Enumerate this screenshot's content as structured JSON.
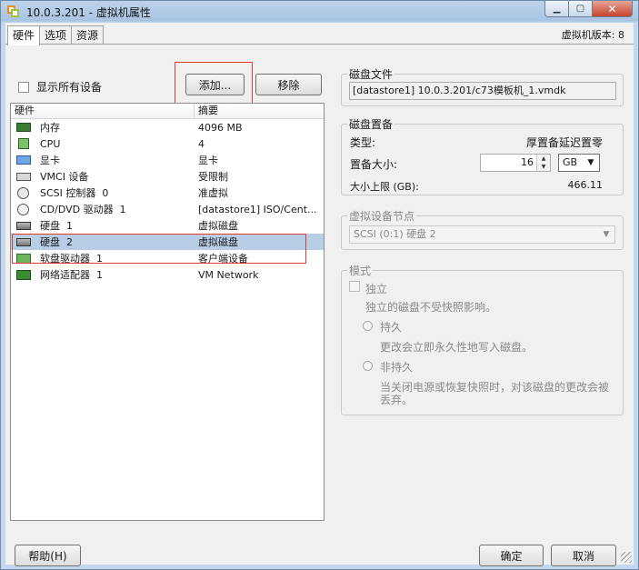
{
  "window": {
    "title": "10.0.3.201 - 虚拟机属性",
    "icons": {
      "app": "vmware-vm-icon",
      "minimize": "minimize-icon",
      "maximize": "maximize-icon",
      "close": "close-icon"
    }
  },
  "tabs": [
    {
      "label": "硬件",
      "active": true
    },
    {
      "label": "选项",
      "active": false
    },
    {
      "label": "资源",
      "active": false
    }
  ],
  "version_label": "虚拟机版本: 8",
  "toolbar": {
    "show_all_label": "显示所有设备",
    "add_label": "添加...",
    "remove_label": "移除"
  },
  "devices": {
    "headers": {
      "hardware": "硬件",
      "summary": "摘要"
    },
    "rows": [
      {
        "name": "内存",
        "summary": "4096 MB",
        "icon": "memory-icon",
        "selected": false
      },
      {
        "name": "CPU",
        "summary": "4",
        "icon": "cpu-icon",
        "selected": false
      },
      {
        "name": "显卡",
        "summary": "显卡",
        "icon": "video-card-icon",
        "selected": false
      },
      {
        "name": "VMCI 设备",
        "summary": "受限制",
        "icon": "vmci-icon",
        "selected": false
      },
      {
        "name": "SCSI 控制器  0",
        "summary": "准虚拟",
        "icon": "scsi-controller-icon",
        "selected": false
      },
      {
        "name": "CD/DVD 驱动器  1",
        "summary": "[datastore1] ISO/Cent...",
        "icon": "cd-dvd-icon",
        "selected": false
      },
      {
        "name": "硬盘  1",
        "summary": "虚拟磁盘",
        "icon": "hard-disk-icon",
        "selected": false
      },
      {
        "name": "硬盘  2",
        "summary": "虚拟磁盘",
        "icon": "hard-disk-icon",
        "selected": true
      },
      {
        "name": "软盘驱动器  1",
        "summary": "客户端设备",
        "icon": "floppy-icon",
        "selected": false
      },
      {
        "name": "网络适配器  1",
        "summary": "VM Network",
        "icon": "network-adapter-icon",
        "selected": false
      }
    ]
  },
  "disk_file": {
    "legend": "磁盘文件",
    "value": "[datastore1] 10.0.3.201/c73模板机_1.vmdk"
  },
  "disk_provisioning": {
    "legend": "磁盘置备",
    "type_label": "类型:",
    "type_value": "厚置备延迟置零",
    "size_label": "置备大小:",
    "size_value": "16",
    "size_unit": "GB",
    "max_label": "大小上限 (GB):",
    "max_value": "466.11"
  },
  "vdev_node": {
    "legend": "虚拟设备节点",
    "value": "SCSI (0:1) 硬盘 2"
  },
  "mode": {
    "legend": "模式",
    "independent_label": "独立",
    "independent_desc": "独立的磁盘不受快照影响。",
    "persistent_label": "持久",
    "persistent_desc": "更改会立即永久性地写入磁盘。",
    "nonpersistent_label": "非持久",
    "nonpersistent_desc_1": "当关闭电源或恢复快照时，对该磁盘的更改会被",
    "nonpersistent_desc_2": "丢弃。"
  },
  "footer": {
    "help_label": "帮助(H)",
    "ok_label": "确定",
    "cancel_label": "取消"
  },
  "colors": {
    "selection": "#b8cde6",
    "highlight_box": "#e03b3b"
  }
}
